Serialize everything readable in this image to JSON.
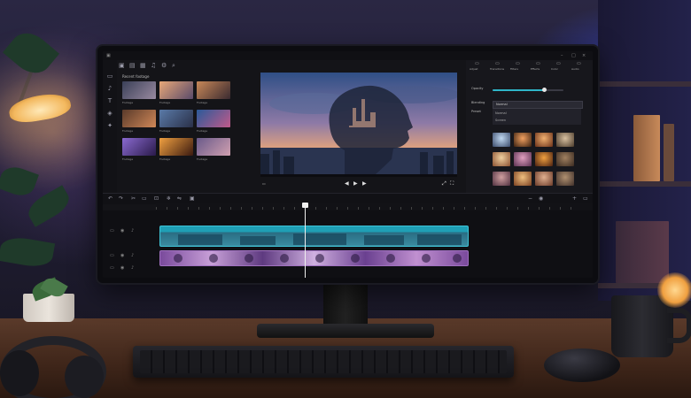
{
  "scene": {
    "description_free": true
  },
  "editor": {
    "media_panel_title": "Recent footage",
    "thumbs": [
      {
        "label": "Footage",
        "c1": "#3a4058",
        "c2": "#9a8aa0"
      },
      {
        "label": "Footage",
        "c1": "#e8a878",
        "c2": "#5a4a6a"
      },
      {
        "label": "Footage",
        "c1": "#c88858",
        "c2": "#3a2a30"
      },
      {
        "label": "Footage",
        "c1": "#5a3a2a",
        "c2": "#d08858"
      },
      {
        "label": "Footage",
        "c1": "#5a7aa8",
        "c2": "#2a3048"
      },
      {
        "label": "Footage",
        "c1": "#2a5a9a",
        "c2": "#c05a8a"
      },
      {
        "label": "Footage",
        "c1": "#8a6ad0",
        "c2": "#2a1a4a"
      },
      {
        "label": "Footage",
        "c1": "#f0a040",
        "c2": "#3a1a10"
      },
      {
        "label": "Footage",
        "c1": "#6a5a8a",
        "c2": "#d0a0b0"
      }
    ],
    "inspector": {
      "tabs": [
        "Adjust",
        "Transitions",
        "Filters",
        "Effects",
        "Color",
        "Audio"
      ],
      "rows": {
        "opacity_label": "Opacity",
        "blending_label": "Blending",
        "preset_label": "Preset"
      },
      "opacity_value": 0.72,
      "dropdown_value": "Normal",
      "dropdown_options": [
        "Normal",
        "Screen"
      ],
      "effects": [
        {
          "c1": "#c0d8f0",
          "c2": "#3a4a6a"
        },
        {
          "c1": "#f0a060",
          "c2": "#3a2010"
        },
        {
          "c1": "#f0b070",
          "c2": "#6a3018"
        },
        {
          "c1": "#d8c0a0",
          "c2": "#4a3a2a"
        },
        {
          "c1": "#f0d0a0",
          "c2": "#8a5030"
        },
        {
          "c1": "#e0a0c0",
          "c2": "#5a3050"
        },
        {
          "c1": "#f0a040",
          "c2": "#4a2010"
        },
        {
          "c1": "#a08060",
          "c2": "#3a2a20"
        },
        {
          "c1": "#d0a0a0",
          "c2": "#503040"
        },
        {
          "c1": "#f0c080",
          "c2": "#7a4020"
        },
        {
          "c1": "#e0b090",
          "c2": "#6a3a28"
        },
        {
          "c1": "#b09070",
          "c2": "#40302a"
        }
      ]
    },
    "timeline": {
      "video_progress": 0.46,
      "ruler_labels": [
        "",
        "",
        "",
        "",
        "",
        "",
        "",
        "",
        "",
        ""
      ]
    }
  },
  "colors": {
    "accent": "#2fb6c8",
    "audio": "#a070c0"
  }
}
